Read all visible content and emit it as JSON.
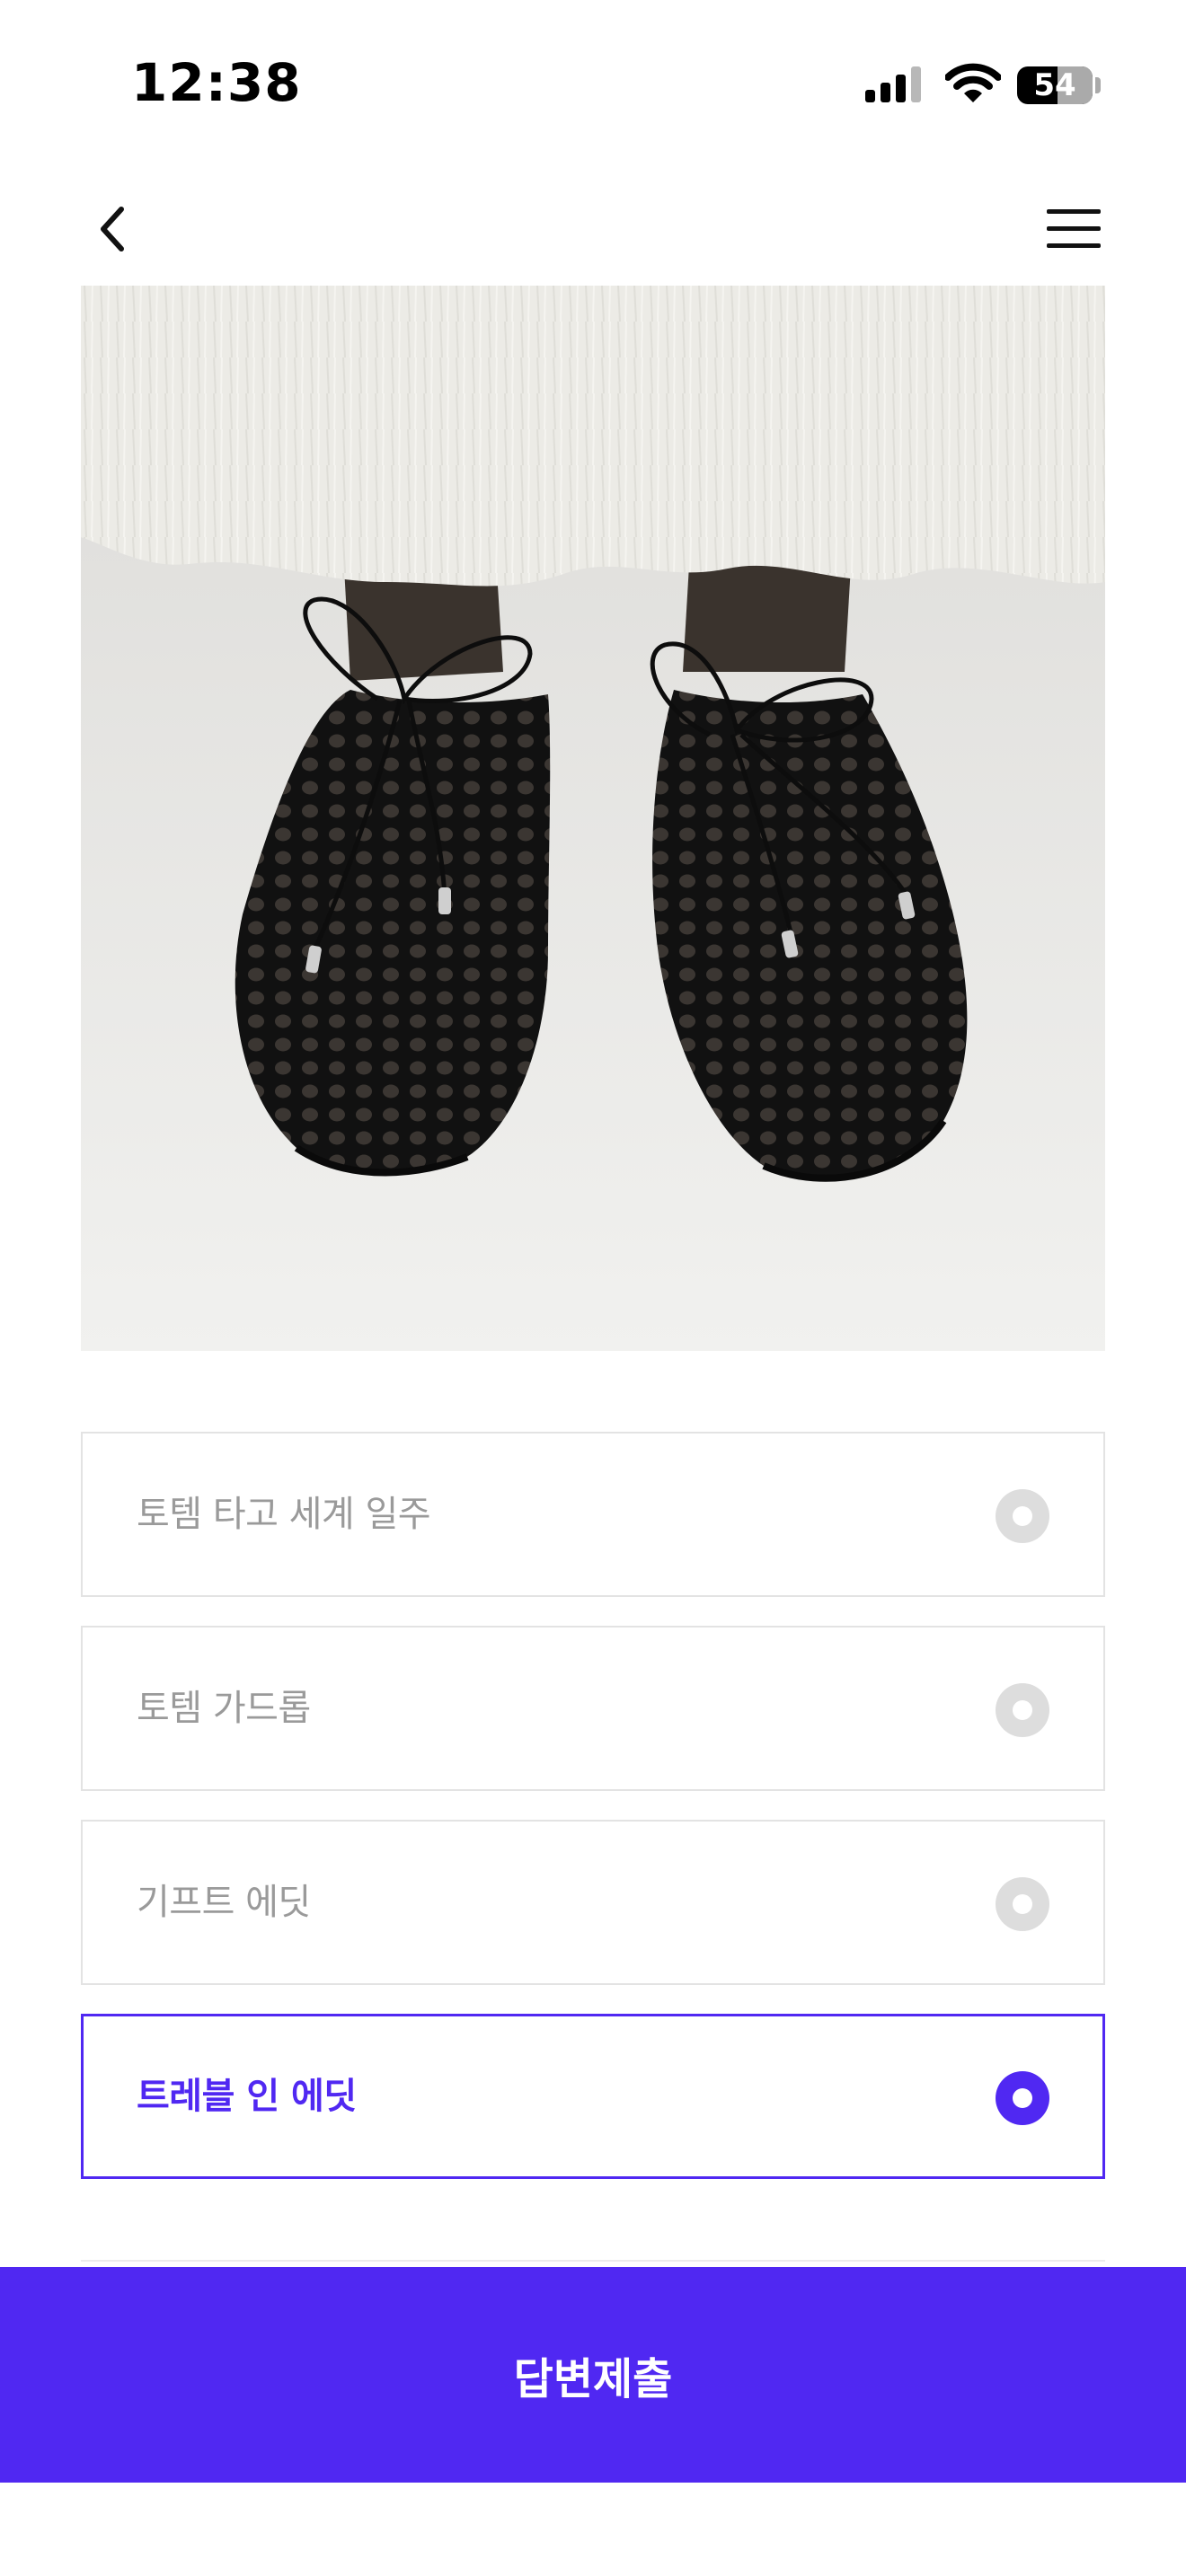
{
  "status_bar": {
    "time": "12:38",
    "battery": "54",
    "battery_level": 0.54,
    "icons": [
      "cellular-signal-icon",
      "wifi-icon",
      "battery-icon"
    ]
  },
  "nav": {
    "back_icon": "chevron-left-icon",
    "menu_icon": "hamburger-menu-icon"
  },
  "product_image": {
    "subject": "black-woven-mesh-flat-shoes-photo"
  },
  "options": [
    {
      "label": "토템 타고 세계 일주",
      "selected": false
    },
    {
      "label": "토템 가드롭",
      "selected": false
    },
    {
      "label": "기프트 에딧",
      "selected": false
    },
    {
      "label": "트레블 인 에딧",
      "selected": true
    }
  ],
  "submit": {
    "label": "답변제출"
  },
  "colors": {
    "accent": "#5028f2",
    "unselected_text": "#9a9a9a",
    "unselected_radio": "#dddddd",
    "border": "#e3e3e3"
  }
}
